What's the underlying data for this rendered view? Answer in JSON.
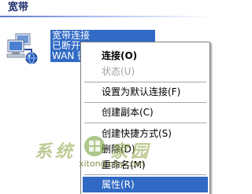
{
  "group": {
    "title": "宽带"
  },
  "connection": {
    "name": "宽带连接",
    "status": "已断开",
    "device": "WAN 微型",
    "icon": "network-connection-icon",
    "selection_color": "#316ac5"
  },
  "menu": {
    "items": [
      {
        "label": "连接(O)",
        "state": "default-bold"
      },
      {
        "label": "状态(U)",
        "state": "disabled"
      },
      {
        "label": "设置为默认连接(F)",
        "state": "normal"
      },
      {
        "label": "创建副本(C)",
        "state": "normal"
      },
      {
        "label": "创建快捷方式(S)",
        "state": "normal"
      },
      {
        "label": "删除(D)",
        "state": "normal"
      },
      {
        "label": "重命名(M)",
        "state": "normal"
      },
      {
        "label": "属性(R)",
        "state": "selected"
      }
    ],
    "highlight_color": "#316ac5"
  },
  "watermark": {
    "text": "xitong city.com",
    "icon": "watermark-logo-icon"
  }
}
